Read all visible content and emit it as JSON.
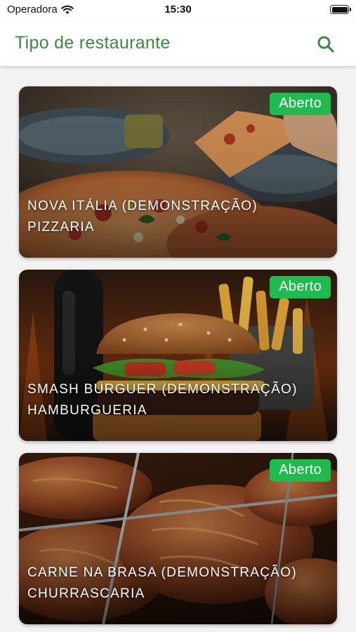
{
  "status_bar": {
    "carrier": "Operadora",
    "time": "15:30"
  },
  "header": {
    "title": "Tipo de restaurante"
  },
  "icons": {
    "wifi": "wifi-icon",
    "battery": "battery-icon",
    "search": "search-icon"
  },
  "colors": {
    "accent": "#3d8a43",
    "badge": "#1fbb4f",
    "background": "#f2f2f2"
  },
  "restaurants": [
    {
      "name": "NOVA ITÁLIA (DEMONSTRAÇÃO)",
      "category": "PIZZARIA",
      "status": "Aberto"
    },
    {
      "name": "SMASH BURGUER (DEMONSTRAÇÃO)",
      "category": "HAMBURGUERIA",
      "status": "Aberto"
    },
    {
      "name": "CARNE NA BRASA (DEMONSTRAÇÃO)",
      "category": "CHURRASCARIA",
      "status": "Aberto"
    }
  ]
}
